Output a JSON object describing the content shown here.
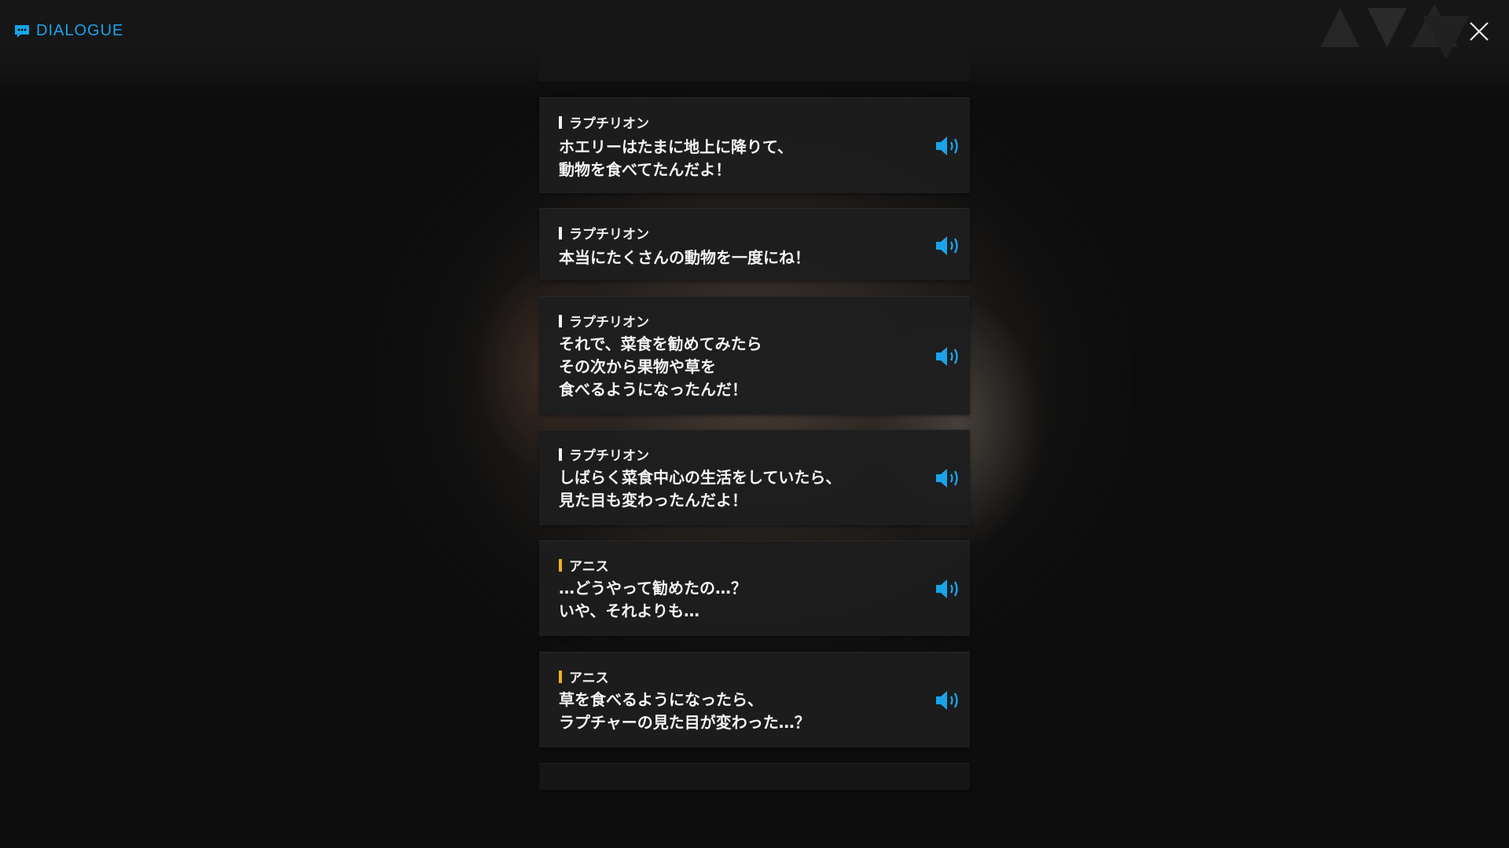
{
  "header": {
    "title": "DIALOGUE"
  },
  "colors": {
    "accent": "#1aa3e8",
    "speaker_bar_white": "#f2f2f2",
    "speaker_bar_gold": "#f0b020",
    "card_bg": "#1e1e1f"
  },
  "icons": {
    "title": "chat-bubble-icon",
    "close": "close-icon",
    "voice": "speaker-volume-icon"
  },
  "dialogues": [
    {
      "speaker": "ラプチリオン",
      "lines": [
        "ホエリーはたまに地上に降りて、",
        "動物を食べてたんだよ！"
      ]
    },
    {
      "speaker": "ラプチリオン",
      "lines": [
        "本当にたくさんの動物を一度にね！"
      ]
    },
    {
      "speaker": "ラプチリオン",
      "lines": [
        "それで、菜食を勧めてみたら",
        "その次から果物や草を",
        "食べるようになったんだ！"
      ]
    },
    {
      "speaker": "ラプチリオン",
      "lines": [
        "しばらく菜食中心の生活をしていたら、",
        "見た目も変わったんだよ！"
      ]
    },
    {
      "speaker": "アニス",
      "lines": [
        "…どうやって勧めたの…？",
        "いや、それよりも…"
      ]
    },
    {
      "speaker": "アニス",
      "lines": [
        "草を食べるようになったら、",
        "ラプチャーの見た目が変わった…？"
      ]
    }
  ]
}
